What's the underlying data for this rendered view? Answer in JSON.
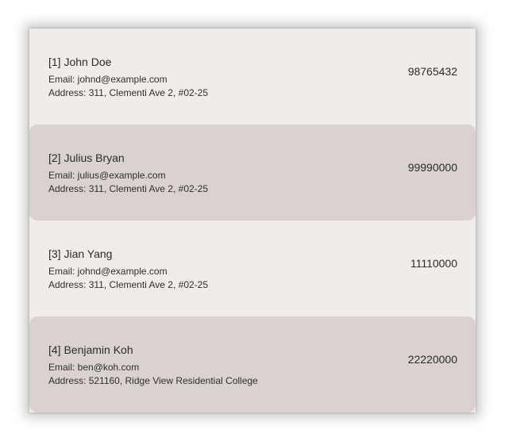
{
  "contacts": [
    {
      "index_name": "[1] John Doe",
      "email": "Email: johnd@example.com",
      "address": "Address: 311, Clementi Ave 2, #02-25",
      "phone": "98765432"
    },
    {
      "index_name": "[2] Julius Bryan",
      "email": "Email: julius@example.com",
      "address": "Address: 311, Clementi Ave 2, #02-25",
      "phone": "99990000"
    },
    {
      "index_name": "[3] Jian Yang",
      "email": "Email: johnd@example.com",
      "address": "Address: 311, Clementi Ave 2, #02-25",
      "phone": "11110000"
    },
    {
      "index_name": "[4] Benjamin Koh",
      "email": "Email: ben@koh.com",
      "address": "Address: 521160, Ridge View Residential College",
      "phone": "22220000"
    }
  ],
  "colors": {
    "card_light": "#f0ecea",
    "card_dark": "#d9d2d0",
    "text": "#2b2b2b"
  }
}
